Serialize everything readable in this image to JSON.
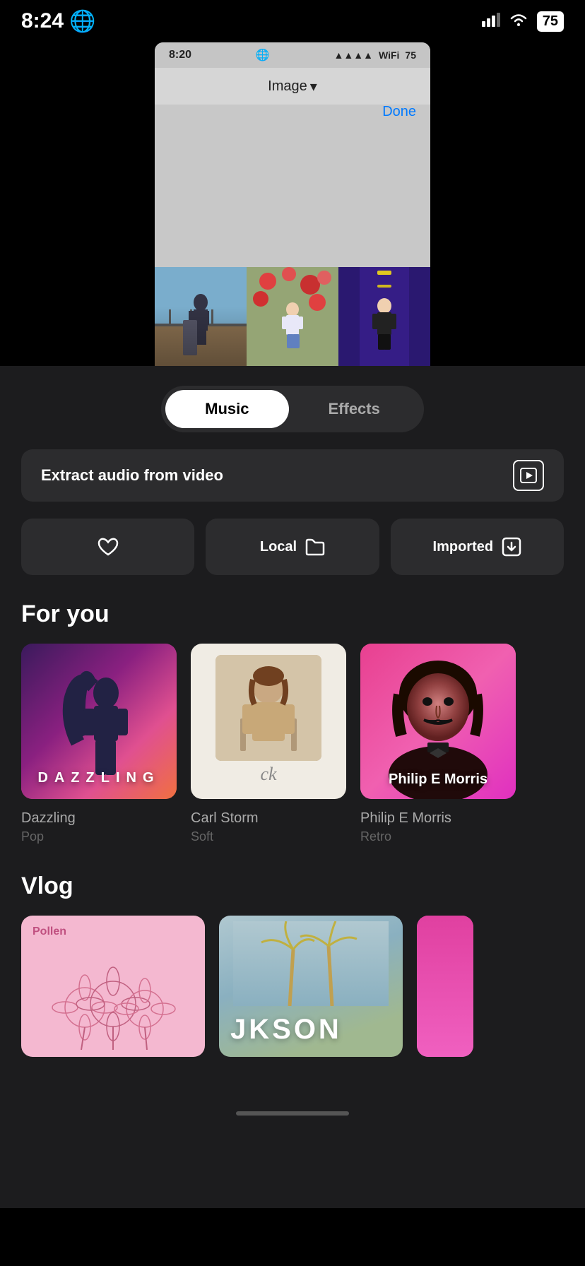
{
  "statusBar": {
    "time": "8:24",
    "globeIcon": "🌐",
    "battery": "75"
  },
  "innerCard": {
    "time": "8:20",
    "globeIcon": "🌐",
    "battery": "75",
    "toolbar": {
      "title": "Image",
      "chevron": "▾",
      "done": "Done"
    }
  },
  "tabs": {
    "music": "Music",
    "effects": "Effects"
  },
  "extractBar": {
    "label": "Extract audio from video"
  },
  "filterButtons": [
    {
      "icon": "heart",
      "label": ""
    },
    {
      "icon": "folder",
      "label": "Local"
    },
    {
      "icon": "import",
      "label": "Imported"
    }
  ],
  "forYou": {
    "title": "For you",
    "cards": [
      {
        "title": "Dazzling",
        "subtitle": "Pop",
        "artText": "DAZZLING"
      },
      {
        "title": "Carl Storm",
        "subtitle": "Soft",
        "sig": "ck"
      },
      {
        "title": "Philip E Morris",
        "subtitle": "Retro",
        "overlayText": "Philip E Morris"
      }
    ]
  },
  "vlog": {
    "title": "Vlog",
    "cards": [
      {
        "label": "Pollen"
      },
      {
        "label": "JKSON"
      },
      {
        "label": ""
      }
    ]
  }
}
